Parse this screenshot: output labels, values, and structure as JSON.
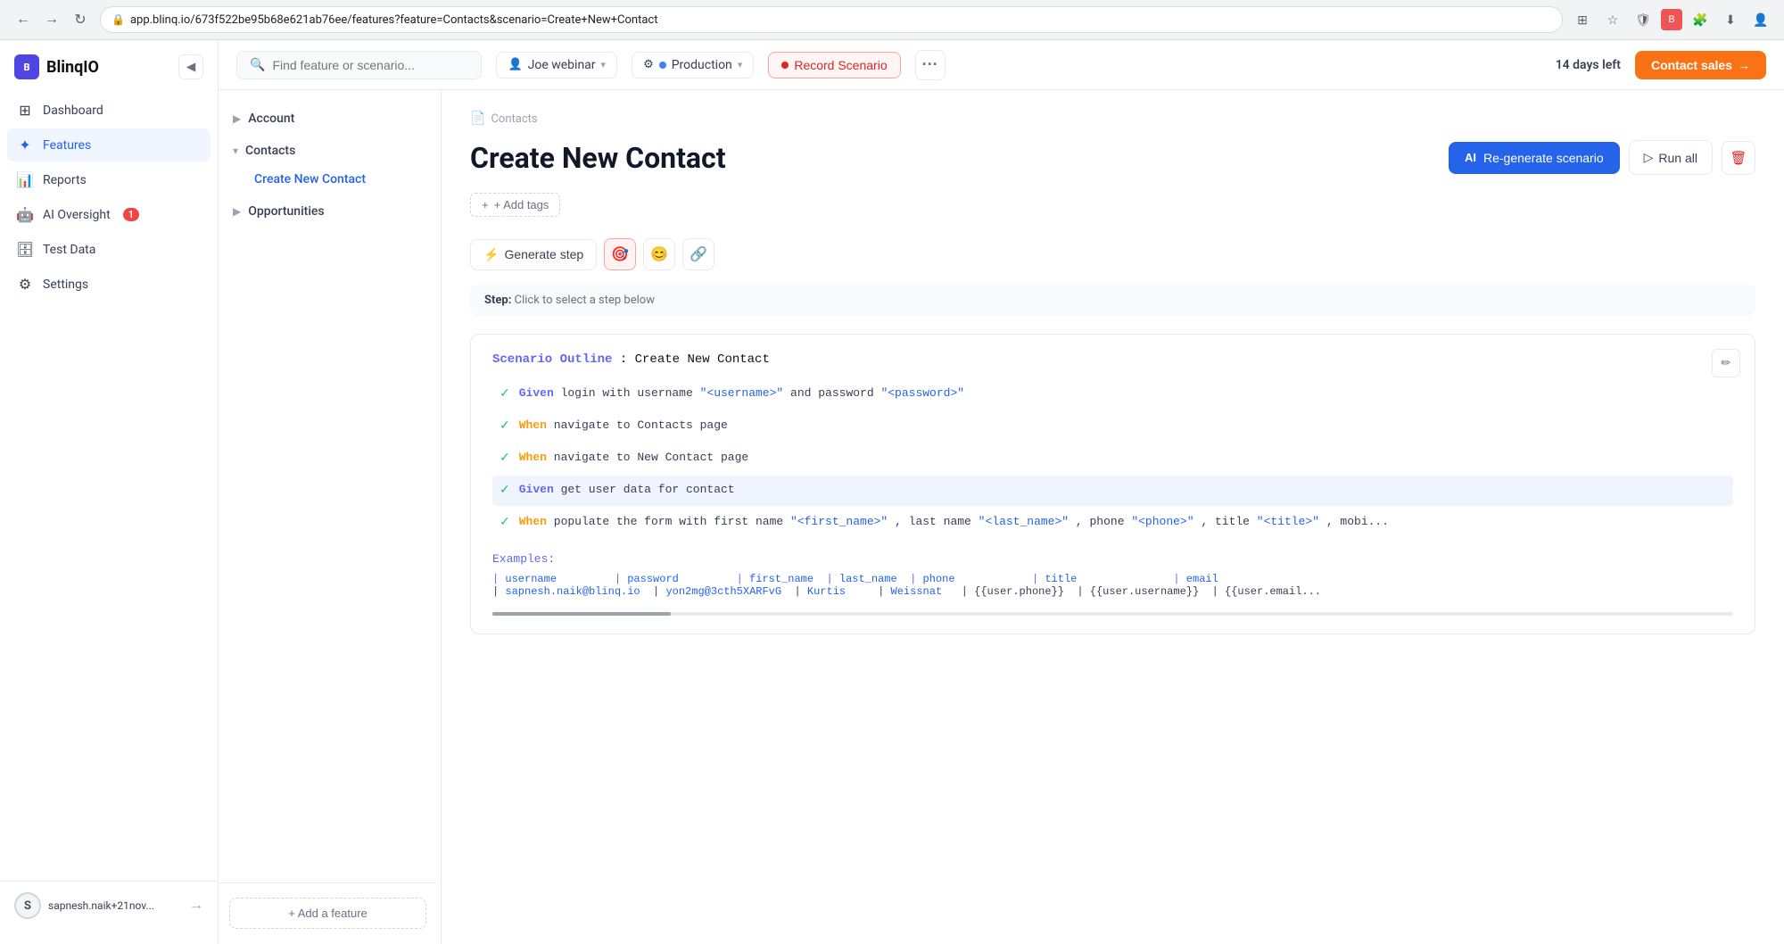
{
  "browser": {
    "url": "app.blinq.io/673f522be95b68e621ab76ee/features?feature=Contacts&scenario=Create+New+Contact",
    "lock_icon": "🔒"
  },
  "app": {
    "logo_text": "BlinqIO",
    "logo_abbr": "B"
  },
  "sidebar": {
    "collapse_icon": "◀",
    "items": [
      {
        "id": "dashboard",
        "label": "Dashboard",
        "icon": "⊞",
        "active": false
      },
      {
        "id": "features",
        "label": "Features",
        "icon": "✦",
        "active": true
      },
      {
        "id": "reports",
        "label": "Reports",
        "icon": "📊",
        "active": false
      },
      {
        "id": "ai-oversight",
        "label": "AI Oversight",
        "icon": "🤖",
        "active": false,
        "badge": "1"
      },
      {
        "id": "test-data",
        "label": "Test Data",
        "icon": "🗄",
        "active": false
      },
      {
        "id": "settings",
        "label": "Settings",
        "icon": "⚙",
        "active": false
      }
    ],
    "user": {
      "name": "sapnesh.naik+21nov...",
      "avatar_initials": "S"
    },
    "logout_icon": "→"
  },
  "topbar": {
    "search_placeholder": "Find feature or scenario...",
    "user_selector": {
      "label": "Joe webinar",
      "icon": "👤"
    },
    "env_selector": {
      "label": "Production",
      "icon": "⚙"
    },
    "record_btn_label": "Record Scenario",
    "more_icon": "...",
    "days_left_label": "14 days left",
    "contact_sales_label": "Contact sales"
  },
  "feature_panel": {
    "sections": [
      {
        "id": "account",
        "label": "Account",
        "expanded": false,
        "items": []
      },
      {
        "id": "contacts",
        "label": "Contacts",
        "expanded": true,
        "items": [
          {
            "id": "create-new-contact",
            "label": "Create New Contact",
            "active": true
          }
        ]
      },
      {
        "id": "opportunities",
        "label": "Opportunities",
        "expanded": false,
        "items": []
      }
    ],
    "add_feature_label": "+ Add a feature"
  },
  "scenario": {
    "breadcrumb": "Contacts",
    "breadcrumb_icon": "📄",
    "title": "Create New Contact",
    "regenerate_label": "Re-generate scenario",
    "run_all_label": "Run all",
    "delete_icon": "🗑",
    "add_tags_label": "+ Add tags",
    "step_toolbar": {
      "generate_step_label": "Generate step",
      "tools": [
        "🎯",
        "😊",
        "🔗"
      ]
    },
    "step_hint": "Click to select a step below",
    "step_label": "Step:",
    "outline": {
      "keyword": "Scenario Outline",
      "title": "Create New Contact",
      "steps": [
        {
          "check": true,
          "keyword": "Given",
          "keyword_type": "given",
          "text": " login with username ",
          "params": [
            "\"<username>\""
          ],
          "middle_text": " and password ",
          "params2": [
            "\"<password>\""
          ],
          "full": "Given login with username \"<username>\" and password \"<password>\""
        },
        {
          "check": true,
          "keyword": "When",
          "keyword_type": "when",
          "text": " navigate to Contacts page",
          "full": "When navigate to Contacts page"
        },
        {
          "check": true,
          "keyword": "When",
          "keyword_type": "when",
          "text": " navigate to New Contact page",
          "full": "When navigate to New Contact page"
        },
        {
          "check": true,
          "keyword": "Given",
          "keyword_type": "given",
          "text": " get user data for contact",
          "highlighted": true,
          "full": "Given get user data for contact"
        },
        {
          "check": true,
          "keyword": "When",
          "keyword_type": "when",
          "text": " populate the form with first name ",
          "params": [
            "\"<first_name>\""
          ],
          "full": "When populate the form with first name \"<first_name>\", last name \"<last_name>\", phone \"<phone>\", title \"<title>\", mobi..."
        }
      ],
      "examples": {
        "title": "Examples:",
        "headers": "| username | password | first_name | last_name | phone | title | email",
        "rows": [
          "| sapnesh.naik@blinq.io | yon2mg@3cth5XARFvG | Kurtis | Weissnat | {{user.phone}} | {{user.username}} | {{user.email..."
        ]
      }
    }
  }
}
